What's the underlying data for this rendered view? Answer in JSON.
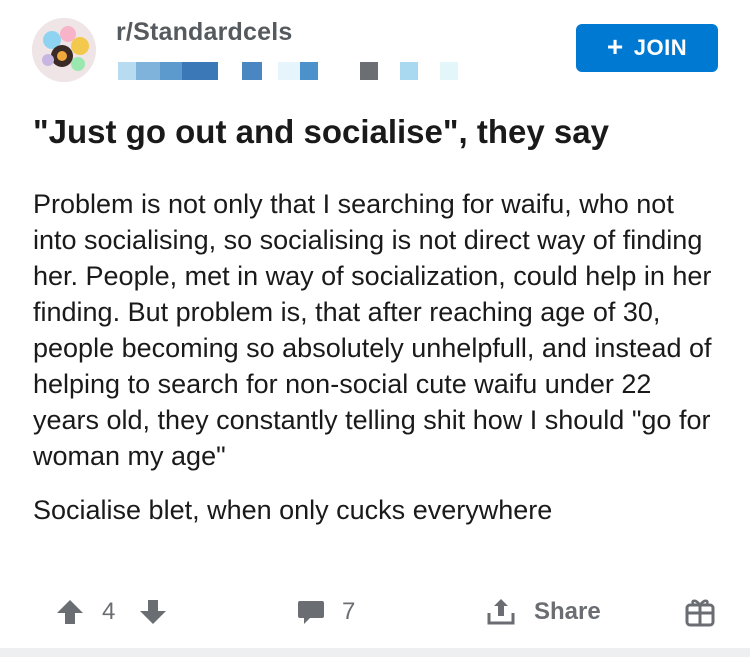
{
  "post": {
    "subreddit": "r/Standardcels",
    "join_label": "JOIN",
    "title": "\"Just go out and socialise\", they say",
    "body_paragraphs": [
      "Problem is not only that I searching for waifu, who not into socialising, so socialising is not direct way of finding her. People, met in way of socialization, could help in her finding. But problem is, that after reaching age of 30, people becoming so absolutely unhelpfull, and instead of helping to search for non-social cute waifu under 22 years old, they constantly telling shit how I should \"go for woman my age\"",
      "Socialise blet, when only cucks everywhere"
    ]
  },
  "actions": {
    "score": "4",
    "comment_count": "7",
    "share_label": "Share"
  },
  "icons": {
    "upvote": "arrow-up-icon",
    "downvote": "arrow-down-icon",
    "comment": "comment-bubble-icon",
    "share": "share-icon",
    "award": "gift-icon",
    "join": "plus-icon"
  },
  "colors": {
    "accent": "#0079d3",
    "icon_gray": "#6a6e73",
    "subreddit_text": "#555a5e"
  }
}
